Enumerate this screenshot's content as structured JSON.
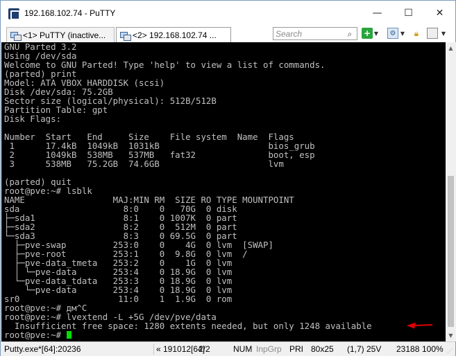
{
  "window": {
    "title": "192.168.102.74 - PuTTY",
    "controls": {
      "minimize": "—",
      "maximize": "☐",
      "close": "✕"
    }
  },
  "tabs": [
    {
      "label": "<1> PuTTY (inactive..."
    },
    {
      "label": "<2> 192.168.102.74 ..."
    }
  ],
  "search": {
    "placeholder": "Search"
  },
  "terminal": {
    "lines": [
      "GNU Parted 3.2",
      "Using /dev/sda",
      "Welcome to GNU Parted! Type 'help' to view a list of commands.",
      "(parted) print",
      "Model: ATA VBOX HARDDISK (scsi)",
      "Disk /dev/sda: 75.2GB",
      "Sector size (logical/physical): 512B/512B",
      "Partition Table: gpt",
      "Disk Flags:",
      "",
      "Number  Start   End     Size    File system  Name  Flags",
      " 1      17.4kB  1049kB  1031kB                     bios_grub",
      " 2      1049kB  538MB   537MB   fat32              boot, esp",
      " 3      538MB   75.2GB  74.6GB                     lvm",
      "",
      "(parted) quit",
      "root@pve:~# lsblk",
      "NAME                 MAJ:MIN RM  SIZE RO TYPE MOUNTPOINT",
      "sda                    8:0    0   70G  0 disk",
      "├─sda1                 8:1    0 1007K  0 part",
      "├─sda2                 8:2    0  512M  0 part",
      "└─sda3                 8:3    0 69.5G  0 part",
      "  ├─pve-swap         253:0    0    4G  0 lvm  [SWAP]",
      "  ├─pve-root         253:1    0  9.8G  0 lvm  /",
      "  ├─pve-data_tmeta   253:2    0    1G  0 lvm",
      "  │ └─pve-data       253:4    0 18.9G  0 lvm",
      "  └─pve-data_tdata   253:3    0 18.9G  0 lvm",
      "    └─pve-data       253:4    0 18.9G  0 lvm",
      "sr0                   11:0    1  1.9G  0 rom",
      "root@pve:~# дм^С",
      "root@pve:~# lvextend -L +5G /dev/pve/data",
      "  Insufficient free space: 1280 extents needed, but only 1248 available",
      "root@pve:~# "
    ]
  },
  "status": {
    "process": "Putty.exe*[64]:20236",
    "position": "« 191012[64]",
    "window": "2/2",
    "caps": "[+]",
    "num": "NUM",
    "input": "InpGrp",
    "priority": "PRI",
    "size": "80x25",
    "cursor": "(1,7) 25V",
    "memory": "23188",
    "zoom": "100%"
  },
  "colors": {
    "terminal_bg": "#000000",
    "terminal_fg": "#c0c0c0",
    "cursor": "#00e000",
    "arrow": "#e00000"
  }
}
